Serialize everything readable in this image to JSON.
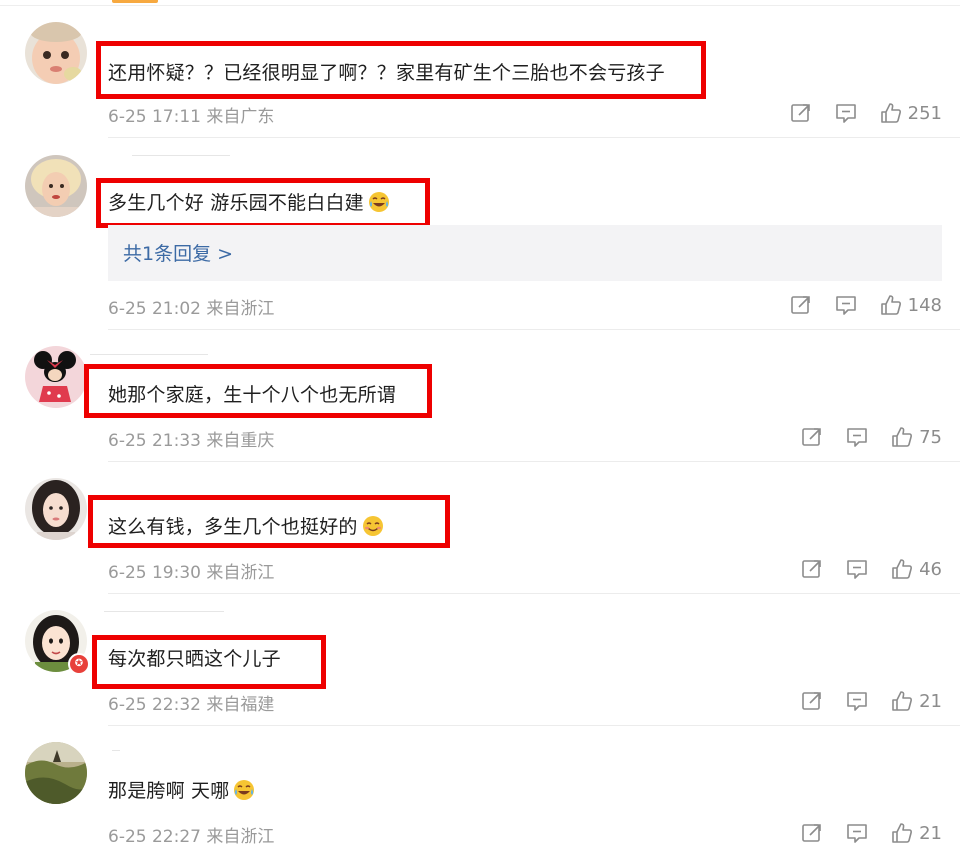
{
  "colors": {
    "highlight": "#ee0000",
    "meta": "#9a9a9a",
    "link": "#3c6aa5",
    "reply_bg": "#f3f3f5"
  },
  "comments": [
    {
      "text": "还用怀疑？？已经很明显了啊？？家里有矿生个三胎也不会亏孩子",
      "time": "6-25 17:11 来自广东",
      "likes": "251",
      "avatar": "baby-avatar"
    },
    {
      "text": "多生几个好 游乐园不能白白建",
      "emoji": "laugh-cry-emoji",
      "reply_link": "共1条回复 >",
      "time": "6-25 21:02 来自浙江",
      "likes": "148",
      "avatar": "blonde-woman-avatar"
    },
    {
      "text": "她那个家庭，生十个八个也无所谓",
      "time": "6-25 21:33 来自重庆",
      "likes": "75",
      "avatar": "minnie-mouse-avatar"
    },
    {
      "text": "这么有钱，多生几个也挺好的",
      "emoji": "smile-emoji",
      "time": "6-25 19:30 来自浙江",
      "likes": "46",
      "avatar": "woman-selfie-avatar"
    },
    {
      "text": "每次都只晒这个儿子",
      "time": "6-25 22:32 来自福建",
      "likes": "21",
      "avatar": "cartoon-girl-avatar"
    },
    {
      "text": "那是胯啊 天哪",
      "emoji": "laugh-cry-emoji",
      "time": "6-25 22:27 来自浙江",
      "likes": "21",
      "avatar": "landscape-avatar"
    }
  ],
  "icons": {
    "share": "share-icon",
    "comment": "comment-icon",
    "like": "thumbs-up-icon"
  }
}
